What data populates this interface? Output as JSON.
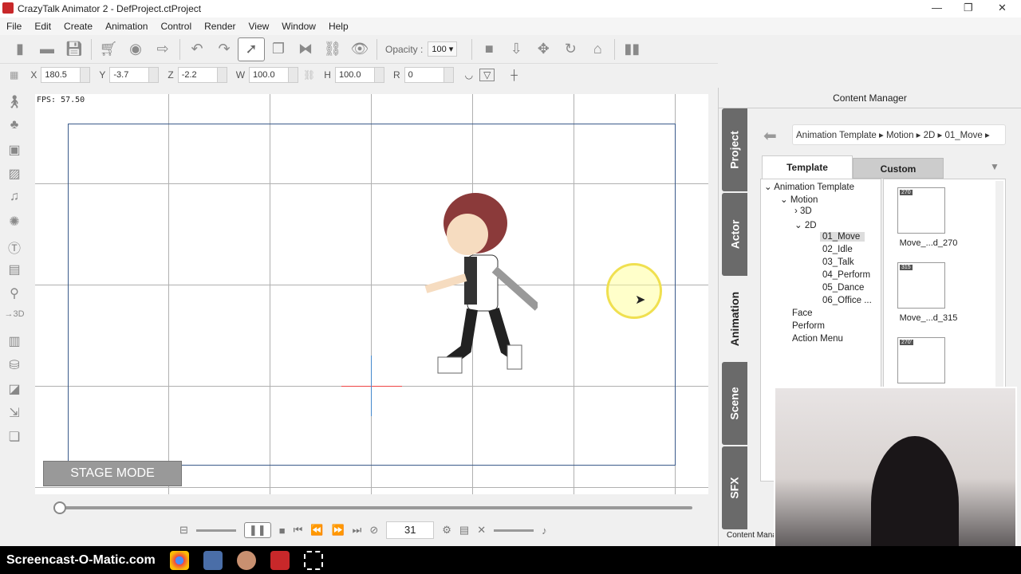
{
  "window": {
    "title": "CrazyTalk Animator 2  - DefProject.ctProject",
    "min": "—",
    "max": "❐",
    "close": "✕"
  },
  "menu": [
    "File",
    "Edit",
    "Create",
    "Animation",
    "Control",
    "Render",
    "View",
    "Window",
    "Help"
  ],
  "toolbar": {
    "opacity_label": "Opacity :",
    "opacity_value": "100"
  },
  "transform": {
    "x_label": "X",
    "x": "180.5",
    "y_label": "Y",
    "y": "-3.7",
    "z_label": "Z",
    "z": "-2.2",
    "w_label": "W",
    "w": "100.0",
    "h_label": "H",
    "h": "100.0",
    "r_label": "R",
    "r": "0"
  },
  "stage": {
    "fps": "FPS: 57.50",
    "mode": "STAGE MODE"
  },
  "timeline": {
    "frame": "31",
    "progress": 0.0
  },
  "content_manager": {
    "title": "Content Manager",
    "side_tabs": [
      "Project",
      "Actor",
      "Animation",
      "Scene",
      "SFX"
    ],
    "active_side_tab": "Animation",
    "breadcrumb": "Animation Template ▸  Motion ▸  2D ▸  01_Move ▸",
    "tabs": [
      "Template",
      "Custom"
    ],
    "tree": {
      "root": "Animation Template",
      "motion": "Motion",
      "d3": "3D",
      "d2": "2D",
      "items": [
        "01_Move",
        "02_Idle",
        "03_Talk",
        "04_Perform",
        "05_Dance",
        "06_Office ..."
      ],
      "others": [
        "Face",
        "Perform",
        "Action Menu"
      ]
    },
    "thumbs": [
      {
        "badge": "270",
        "label": "Move_...d_270"
      },
      {
        "badge": "315",
        "label": "Move_...d_315"
      },
      {
        "badge": "270'",
        "label": ""
      }
    ],
    "bottom_tab": "Content Mana"
  },
  "taskbar": {
    "brand": "Screencast-O-Matic.com"
  }
}
